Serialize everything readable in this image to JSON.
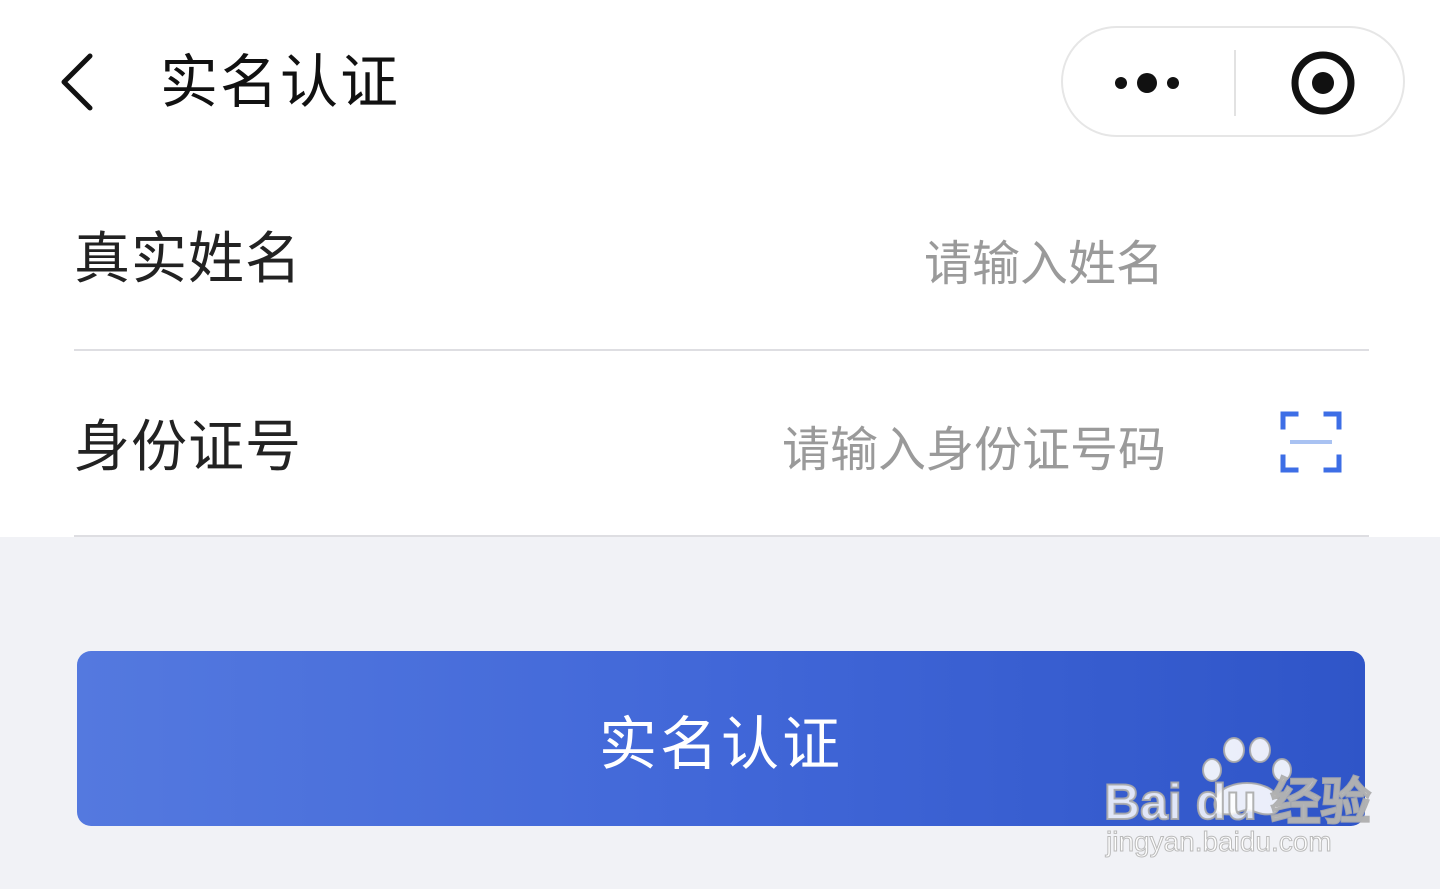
{
  "header": {
    "title": "实名认证",
    "back_icon": "chevron-left-icon",
    "capsule": {
      "more_icon": "more-dots-icon",
      "close_icon": "target-close-icon"
    }
  },
  "form": {
    "name": {
      "label": "真实姓名",
      "value": "",
      "placeholder": "请输入姓名"
    },
    "id_number": {
      "label": "身份证号",
      "value": "",
      "placeholder": "请输入身份证号码",
      "scan_icon": "scan-icon"
    }
  },
  "submit": {
    "label": "实名认证"
  },
  "watermark": {
    "brand": "Bai du 经验",
    "url": "jingyan.baidu.com"
  },
  "colors": {
    "page_background": "#f1f2f6",
    "card_background": "#ffffff",
    "accent": "#4167d8",
    "scan_icon_blue": "#3d6ee6",
    "placeholder": "#9a9a9a"
  }
}
